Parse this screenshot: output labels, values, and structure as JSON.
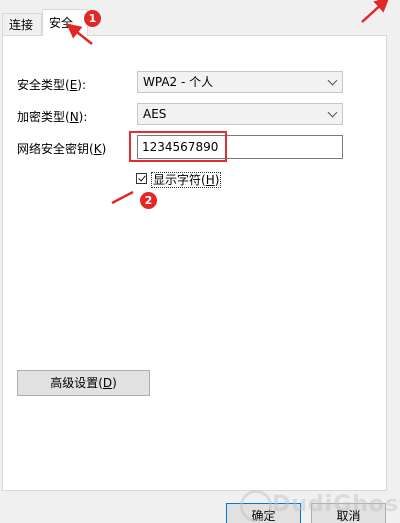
{
  "tabs": {
    "connect": "连接",
    "security": "安全"
  },
  "form": {
    "security_type_label": "安全类型(",
    "security_type_key": "E",
    "security_type_suffix": "):",
    "security_type_value": "WPA2 - 个人",
    "encryption_type_label": "加密类型(",
    "encryption_type_key": "N",
    "encryption_type_suffix": "):",
    "encryption_type_value": "AES",
    "network_key_label": "网络安全密钥(",
    "network_key_key": "K",
    "network_key_suffix": ")",
    "network_key_value": "1234567890",
    "show_chars_label": "显示字符(",
    "show_chars_key": "H",
    "show_chars_suffix": ")",
    "show_chars_checked": true
  },
  "buttons": {
    "advanced_label": "高级设置(",
    "advanced_key": "D",
    "advanced_suffix": ")",
    "ok_label": "确定",
    "cancel_label": "取消"
  },
  "annotations": {
    "badge_1": "1",
    "badge_2": "2",
    "color": "#e32626"
  },
  "watermark": "DudiGhost.com"
}
